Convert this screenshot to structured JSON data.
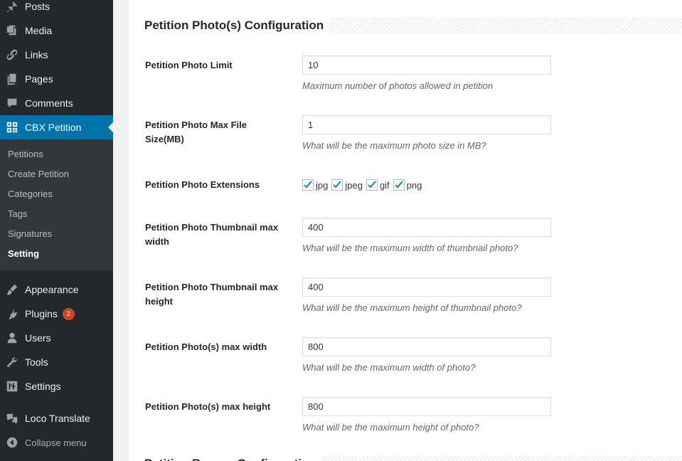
{
  "sidebar": {
    "menu": {
      "posts": "Posts",
      "media": "Media",
      "links": "Links",
      "pages": "Pages",
      "comments": "Comments",
      "cbx_petition": "CBX Petition",
      "appearance": "Appearance",
      "plugins": "Plugins",
      "plugins_badge": "2",
      "users": "Users",
      "tools": "Tools",
      "settings": "Settings",
      "loco": "Loco Translate",
      "collapse": "Collapse menu"
    },
    "submenu": {
      "petitions": "Petitions",
      "create": "Create Petition",
      "categories": "Categories",
      "tags": "Tags",
      "signatures": "Signatures",
      "setting": "Setting"
    }
  },
  "main": {
    "section_title": "Petition Photo(s) Configuration",
    "next_section_title": "Petition Banner Configuration",
    "fields": {
      "limit": {
        "label": "Petition Photo Limit",
        "value": "10",
        "desc": "Maximum number of photos allowed in petition"
      },
      "max_size": {
        "label_line1": "Petition Photo Max File",
        "label_line2": "Size(MB)",
        "value": "1",
        "desc": "What will be the maximum photo size in MB?"
      },
      "extensions": {
        "label": "Petition Photo Extensions",
        "options": [
          "jpg",
          "jpeg",
          "gif",
          "png"
        ]
      },
      "thumb_width": {
        "label_line1": "Petition Photo Thumbnail max",
        "label_line2": "width",
        "value": "400",
        "desc": "What will be the maximum width of thumbnail photo?"
      },
      "thumb_height": {
        "label_line1": "Petition Photo Thumbnail max",
        "label_line2": "height",
        "value": "400",
        "desc": "What will be the maximum height of thumbnail photo?"
      },
      "max_width": {
        "label": "Petition Photo(s) max width",
        "value": "800",
        "desc": "What will be the maximum width of photo?"
      },
      "max_height": {
        "label": "Petition Photo(s) max height",
        "value": "800",
        "desc": "What will be the maximum height of photo?"
      }
    }
  },
  "colors": {
    "sidebar_bg": "#23282d",
    "submenu_bg": "#32373c",
    "accent": "#0073aa",
    "badge": "#ca4a1f",
    "check": "#1e8cbe"
  }
}
